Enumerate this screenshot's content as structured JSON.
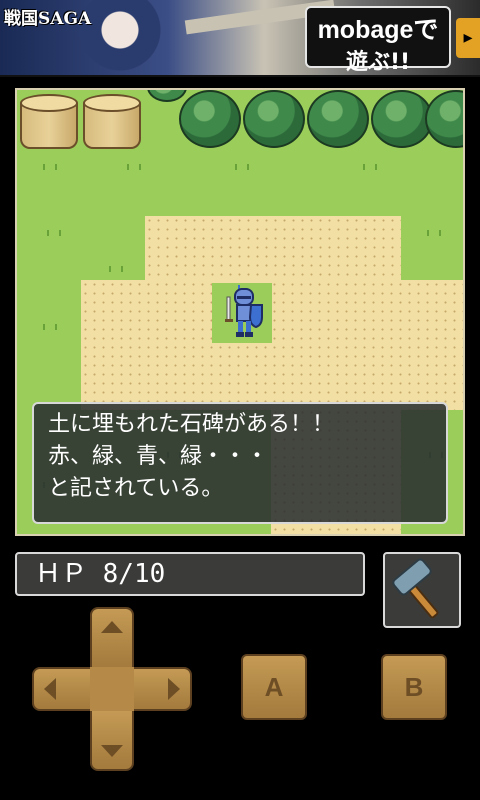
{
  "banner": {
    "title": "戦国SAGA",
    "cta_line1": "mobageで",
    "cta_line2": "遊ぶ!!",
    "arrow": "▸"
  },
  "dialog": {
    "lines": [
      "土に埋もれた石碑がある！！",
      "赤、緑、青、緑・・・",
      "と記されている。"
    ]
  },
  "status": {
    "hp_text": "ＨＰ 8/10"
  },
  "item_slot": {
    "icon": "hammer-icon"
  },
  "controls": {
    "dpad_icons": [
      "up-arrow-icon",
      "down-arrow-icon",
      "left-arrow-icon",
      "right-arrow-icon"
    ],
    "a_label": "A",
    "b_label": "B"
  },
  "colors": {
    "grass": "#9acd5a",
    "sand": "#f1dfa3",
    "button": "#b58a48"
  }
}
